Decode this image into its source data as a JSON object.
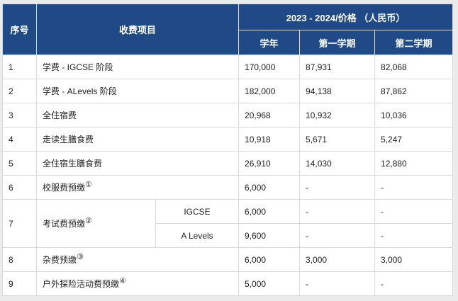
{
  "header": {
    "seq": "序号",
    "item": "收费项目",
    "period": "2023 - 2024/价格 （人民币）",
    "year": "学年",
    "term1": "第一学期",
    "term2": "第二学期"
  },
  "rows": [
    {
      "seq": "1",
      "item": "学费 - IGCSE 阶段",
      "note": "",
      "year": "170,000",
      "term1": "87,931",
      "term2": "82,068"
    },
    {
      "seq": "2",
      "item": "学费 - ALevels 阶段",
      "note": "",
      "year": "182,000",
      "term1": "94,138",
      "term2": "87,862"
    },
    {
      "seq": "3",
      "item": "全住宿费",
      "note": "",
      "year": "20,968",
      "term1": "10,932",
      "term2": "10,036"
    },
    {
      "seq": "4",
      "item": "走读生膳食费",
      "note": "",
      "year": "10,918",
      "term1": "5,671",
      "term2": "5,247"
    },
    {
      "seq": "5",
      "item": "全住宿生膳食费",
      "note": "",
      "year": "26,910",
      "term1": "14,030",
      "term2": "12,880"
    },
    {
      "seq": "6",
      "item": "校服费预缴",
      "note": "①",
      "year": "6,000",
      "term1": "-",
      "term2": "-"
    }
  ],
  "exam": {
    "seq": "7",
    "item": "考试费预缴",
    "note": "②",
    "sub": [
      {
        "label": "IGCSE",
        "year": "6,000",
        "term1": "-",
        "term2": "-"
      },
      {
        "label": "A Levels",
        "year": "9,600",
        "term1": "-",
        "term2": "-"
      }
    ]
  },
  "rows_after": [
    {
      "seq": "8",
      "item": "杂费预缴",
      "note": "③",
      "year": "6,000",
      "term1": "3,000",
      "term2": "3,000"
    },
    {
      "seq": "9",
      "item": "户外探险活动费预缴",
      "note": "④",
      "year": "5,000",
      "term1": "-",
      "term2": "-"
    }
  ]
}
